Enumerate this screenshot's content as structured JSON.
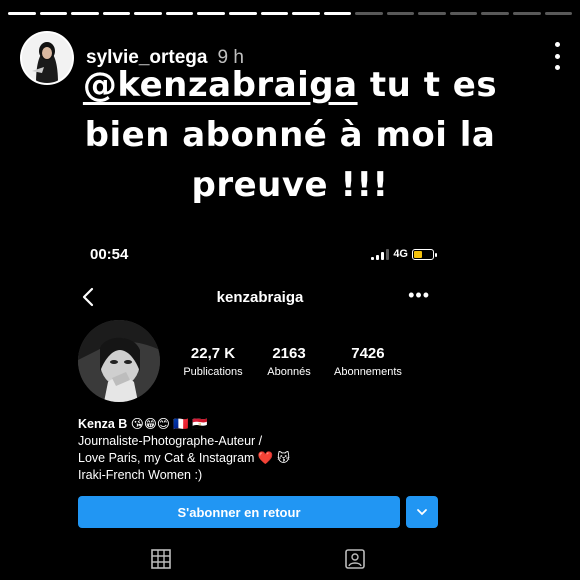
{
  "story": {
    "username": "sylvie_ortega",
    "time": "9 h",
    "caption_mention": "@kenzabraiga",
    "caption_rest": " tu t es bien abonné à moi la preuve !!!",
    "segments": 18,
    "current_segment": 11
  },
  "screenshot": {
    "status": {
      "time": "00:54",
      "network": "4G",
      "battery_level": 0.45,
      "battery_color": "#f4c20d"
    },
    "nav": {
      "title": "kenzabraiga",
      "back_icon": "chevron-left-icon",
      "more_icon": "more-horizontal-icon"
    },
    "stats": [
      {
        "num": "22,7 K",
        "label": "Publications"
      },
      {
        "num": "2163",
        "label": "Abonnés"
      },
      {
        "num": "7426",
        "label": "Abonnements"
      }
    ],
    "bio": {
      "name": "Kenza B 😘😁😊 🇫🇷 🇪🇬",
      "line1": "Journaliste-Photographe-Auteur /",
      "line2": "Love Paris, my Cat & Instagram ❤️ 😽",
      "line3": "Iraki-French Women :)"
    },
    "follow_button": "S'abonner en retour",
    "accent_color": "#2196f3",
    "tabs": [
      "grid-icon",
      "tagged-icon"
    ]
  }
}
